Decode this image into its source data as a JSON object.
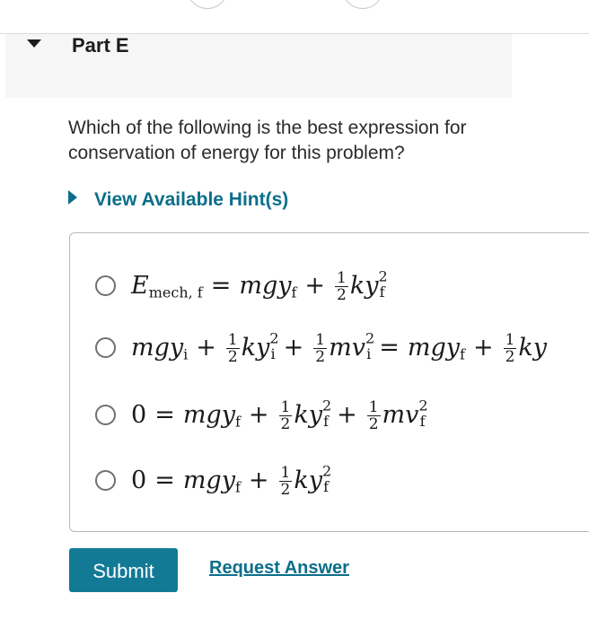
{
  "part": {
    "title": "Part E"
  },
  "question": {
    "text": "Which of the following is the best expression for conservation of energy for this problem?"
  },
  "hint": {
    "label": "View Available Hint(s)"
  },
  "options": [
    {
      "expression": "E_mech, f = m g y_f + 1/2 k y_f^2"
    },
    {
      "expression": "m g y_i + 1/2 k y_i^2 + 1/2 m v_i^2 = m g y_f + 1/2 k y..."
    },
    {
      "expression": "0 = m g y_f + 1/2 k y_f^2 + 1/2 m v_f^2"
    },
    {
      "expression": "0 = m g y_f + 1/2 k y_f^2"
    }
  ],
  "actions": {
    "submit_label": "Submit",
    "request_answer_label": "Request Answer"
  },
  "colors": {
    "accent": "#137a96",
    "link": "#0b6e8a",
    "header_bg": "#f6f6f6"
  }
}
